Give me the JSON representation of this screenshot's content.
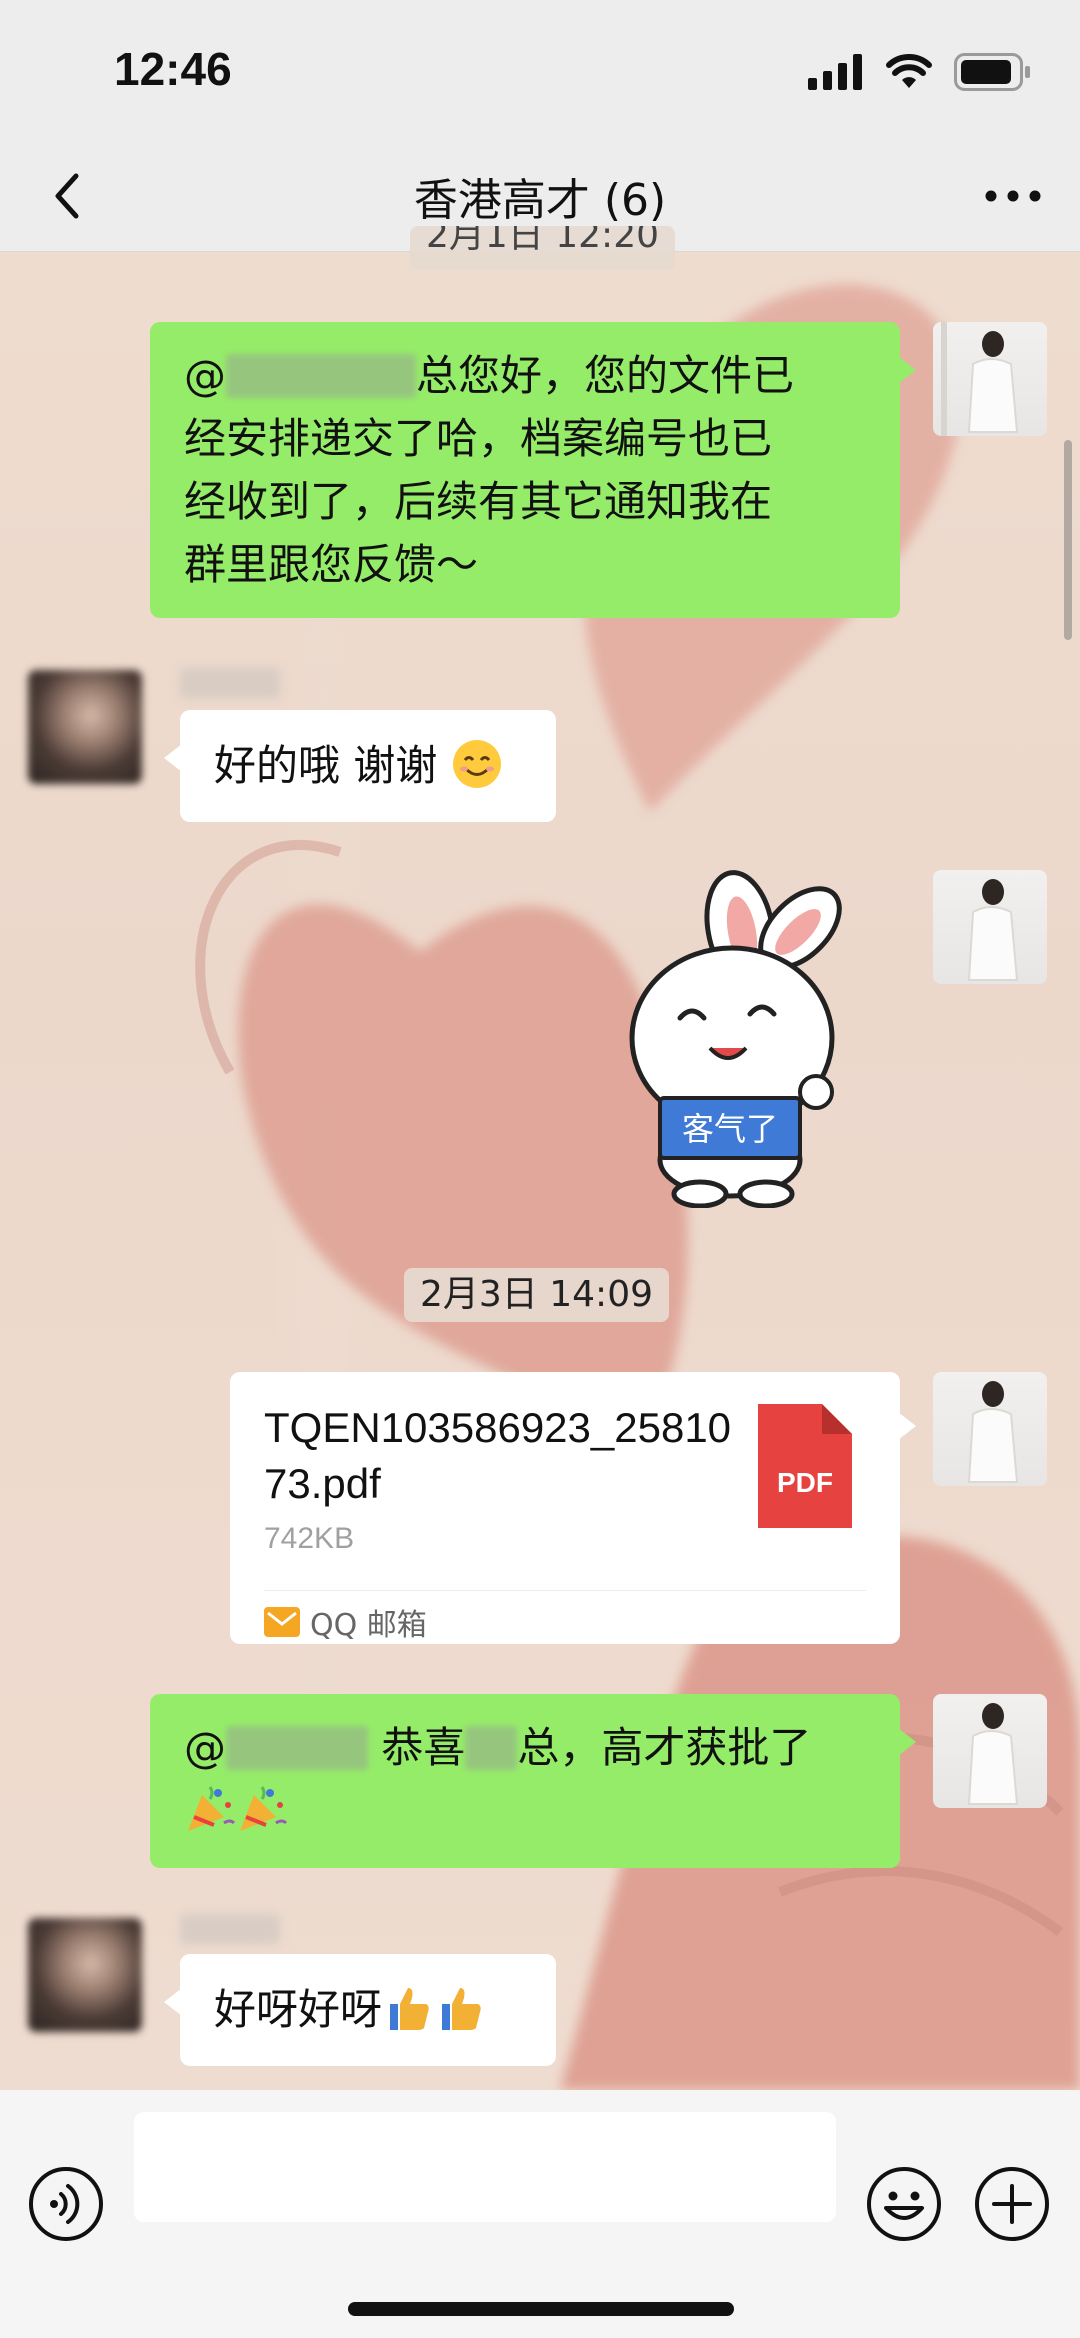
{
  "status_bar": {
    "time": "12:46"
  },
  "header": {
    "title": "香港高才 (6)"
  },
  "timestamps": {
    "partial": "2月1日 12:20",
    "date2": "2月3日 14:09"
  },
  "messages": {
    "m1": {
      "at": "@",
      "text_after_redact": "总您好，您的文件已",
      "line2": "经安排递交了哈，档案编号也已",
      "line3": "经收到了，后续有其它通知我在",
      "line4": "群里跟您反馈～"
    },
    "m2": {
      "text": "好的哦 谢谢"
    },
    "sticker": {
      "text": "客气了"
    },
    "file": {
      "name": "TQEN103586923_2581073.pdf",
      "size": "742KB",
      "icon_label": "PDF",
      "source": "QQ 邮箱"
    },
    "m4": {
      "at": "@",
      "text1": " 恭喜",
      "text2": "总，高才获批了"
    },
    "m5": {
      "text": "好呀好呀"
    }
  },
  "colors": {
    "green_bubble": "#95ec69",
    "white_bubble": "#ffffff",
    "pdf_red": "#e64340",
    "nav_bg": "#ededed"
  },
  "icons": {
    "back": "chevron-left-icon",
    "more": "more-dots-icon",
    "voice": "voice-icon",
    "emoji": "emoji-icon",
    "plus": "plus-icon"
  }
}
